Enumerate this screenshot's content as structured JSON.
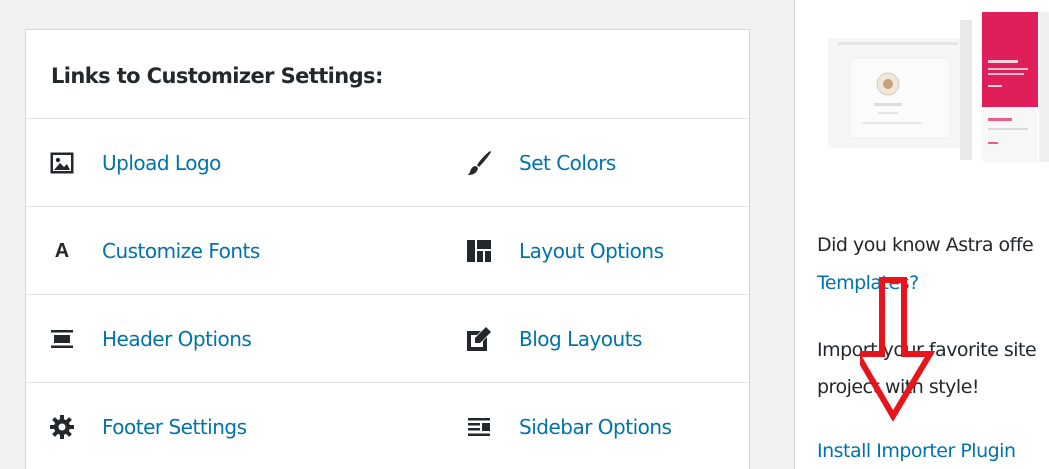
{
  "panel": {
    "title": "Links to Customizer Settings:",
    "rows": [
      [
        {
          "label": "Upload Logo",
          "icon": "format-image-icon"
        },
        {
          "label": "Set Colors",
          "icon": "paintbrush-icon"
        }
      ],
      [
        {
          "label": "Customize Fonts",
          "icon": "editor-textcolor-icon"
        },
        {
          "label": "Layout Options",
          "icon": "layout-icon"
        }
      ],
      [
        {
          "label": "Header Options",
          "icon": "align-center-icon"
        },
        {
          "label": "Blog Layouts",
          "icon": "welcome-write-blog-icon"
        }
      ],
      [
        {
          "label": "Footer Settings",
          "icon": "admin-generic-icon"
        },
        {
          "label": "Sidebar Options",
          "icon": "align-right-icon"
        }
      ]
    ],
    "font_icon_glyph": "A"
  },
  "sidebar": {
    "intro_line1": "Did you know Astra offe",
    "intro_link": "Templates?",
    "body_line1": "Import your favorite site",
    "body_line2": "project with style!",
    "install_link": "Install Importer Plugin"
  },
  "colors": {
    "link": "#0073aa",
    "text": "#23282d",
    "border": "#e2e4e7",
    "annotation_arrow": "#e8141c",
    "preview_accent": "#e01e5a"
  }
}
